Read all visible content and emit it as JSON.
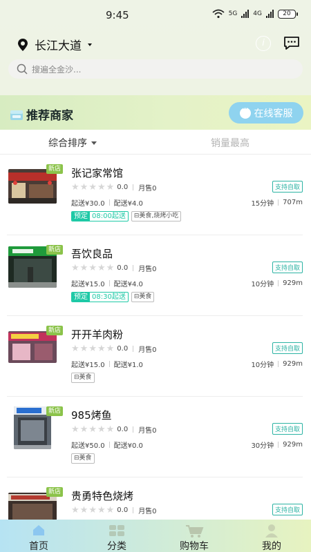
{
  "status_bar": {
    "time": "9:45",
    "network_1": "5G",
    "network_2": "4G",
    "battery": "20"
  },
  "header": {
    "location": "长江大道",
    "search_placeholder": "搜遍全金沙...",
    "info_icon": "info-circle-icon",
    "message_icon": "chat-bubble-icon"
  },
  "section": {
    "title": "推荐商家",
    "customer_service_label": "在线客服"
  },
  "sort": {
    "default_label": "综合排序",
    "sales_label": "销量最高"
  },
  "shops": [
    {
      "name": "张记家常馆",
      "badge": "新店",
      "rating": "0.0",
      "monthly": "月售0",
      "pickup": "支持自取",
      "min_order": "起送¥30.0",
      "delivery_fee": "配送¥4.0",
      "time": "15分钟",
      "distance": "707m",
      "preorder_label": "预定",
      "preorder_time": "08:00起送",
      "category": "美食,烧烤小吃"
    },
    {
      "name": "吾饮良品",
      "badge": "新店",
      "rating": "0.0",
      "monthly": "月售0",
      "pickup": "支持自取",
      "min_order": "起送¥15.0",
      "delivery_fee": "配送¥4.0",
      "time": "10分钟",
      "distance": "929m",
      "preorder_label": "预定",
      "preorder_time": "08:30起送",
      "category": "美食"
    },
    {
      "name": "开开羊肉粉",
      "badge": "新店",
      "rating": "0.0",
      "monthly": "月售0",
      "pickup": "支持自取",
      "min_order": "起送¥15.0",
      "delivery_fee": "配送¥1.0",
      "time": "10分钟",
      "distance": "929m",
      "category": "美食"
    },
    {
      "name": "985烤鱼",
      "badge": "新店",
      "rating": "0.0",
      "monthly": "月售0",
      "pickup": "支持自取",
      "min_order": "起送¥50.0",
      "delivery_fee": "配送¥0.0",
      "time": "30分钟",
      "distance": "929m",
      "category": "美食"
    },
    {
      "name": "贵勇特色烧烤",
      "badge": "新店",
      "rating": "0.0",
      "monthly": "月售0",
      "pickup": "支持自取"
    }
  ],
  "tabs": [
    {
      "label": "首页",
      "icon": "home-icon"
    },
    {
      "label": "分类",
      "icon": "category-icon"
    },
    {
      "label": "购物车",
      "icon": "cart-icon"
    },
    {
      "label": "我的",
      "icon": "user-icon"
    }
  ]
}
